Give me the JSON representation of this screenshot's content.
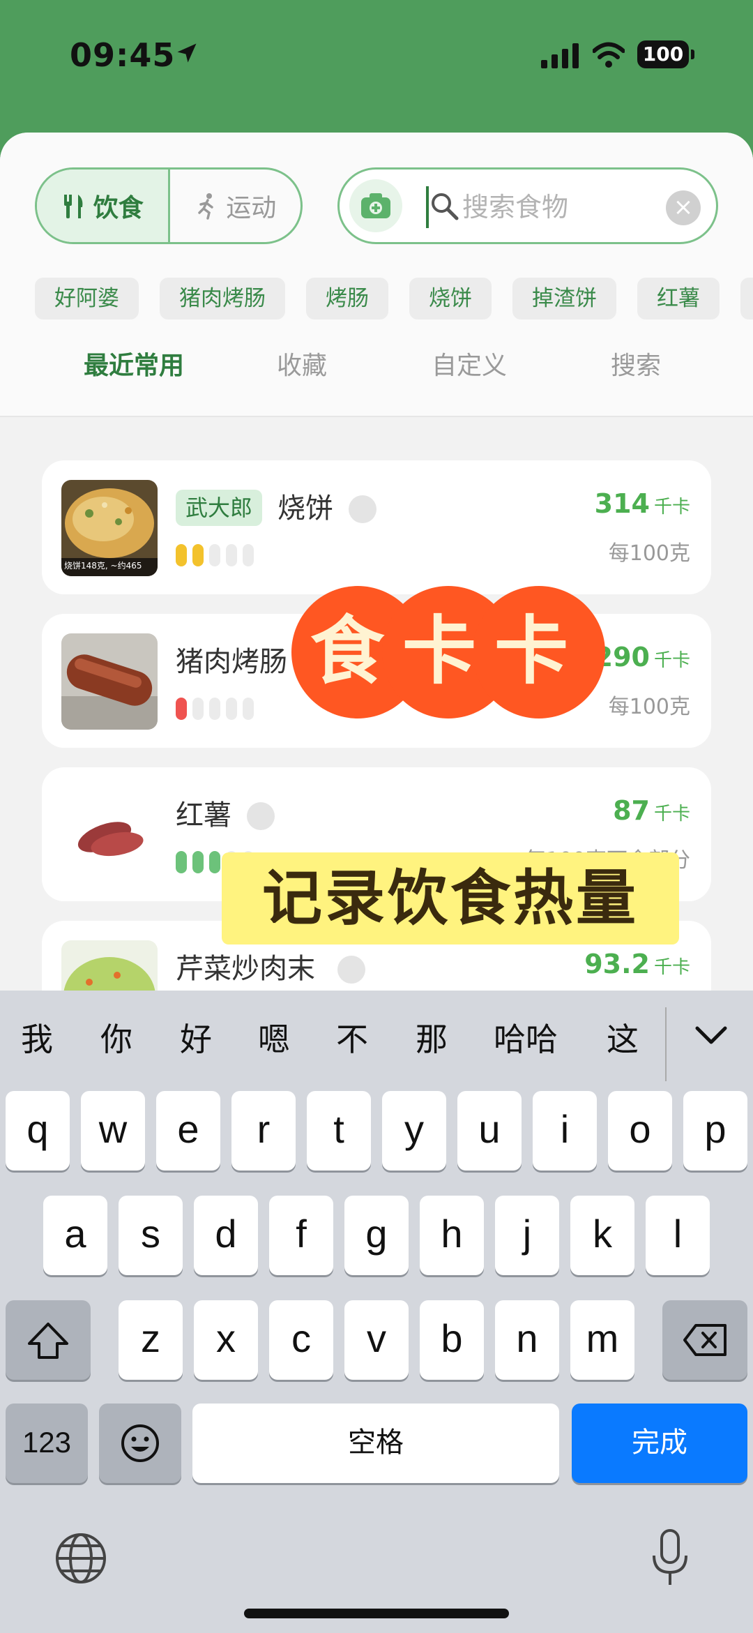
{
  "status_bar": {
    "time": "09:45",
    "battery": "100"
  },
  "segment": {
    "diet_label": "饮食",
    "exercise_label": "运动"
  },
  "search": {
    "placeholder": "搜索食物",
    "value": ""
  },
  "chips": [
    "好阿婆",
    "猪肉烤肠",
    "烤肠",
    "烧饼",
    "掉渣饼",
    "红薯"
  ],
  "tabs": [
    "最近常用",
    "收藏",
    "自定义",
    "搜索"
  ],
  "foods": [
    {
      "brand": "武大郎",
      "name": "烧饼",
      "kcal": "314",
      "unit": "千卡",
      "per": "每100克",
      "thumb_caption": "烧饼148克, ~约465",
      "level_color": "#f3c22c",
      "level": 2
    },
    {
      "brand": "",
      "name": "猪肉烤肠",
      "kcal": "290",
      "unit": "千卡",
      "per": "每100克",
      "level_color": "#ef5350",
      "level": 1
    },
    {
      "brand": "",
      "name": "红薯",
      "kcal": "87",
      "unit": "千卡",
      "per": "每100克可食部分",
      "level_color": "#6cc27a",
      "level": 3
    },
    {
      "brand": "",
      "name": "芹菜炒肉末",
      "kcal": "93.2",
      "unit": "千卡",
      "per": "",
      "level_color": "#6cc27a",
      "level": 3
    }
  ],
  "overlay": {
    "badge_text": "食卡卡",
    "caption": "记录饮食热量"
  },
  "keyboard": {
    "candidates": [
      "我",
      "你",
      "好",
      "嗯",
      "不",
      "那",
      "哈哈",
      "这"
    ],
    "row1": [
      "q",
      "w",
      "e",
      "r",
      "t",
      "y",
      "u",
      "i",
      "o",
      "p"
    ],
    "row2": [
      "a",
      "s",
      "d",
      "f",
      "g",
      "h",
      "j",
      "k",
      "l"
    ],
    "row3": [
      "z",
      "x",
      "c",
      "v",
      "b",
      "n",
      "m"
    ],
    "numbers_label": "123",
    "space_label": "空格",
    "done_label": "完成"
  }
}
